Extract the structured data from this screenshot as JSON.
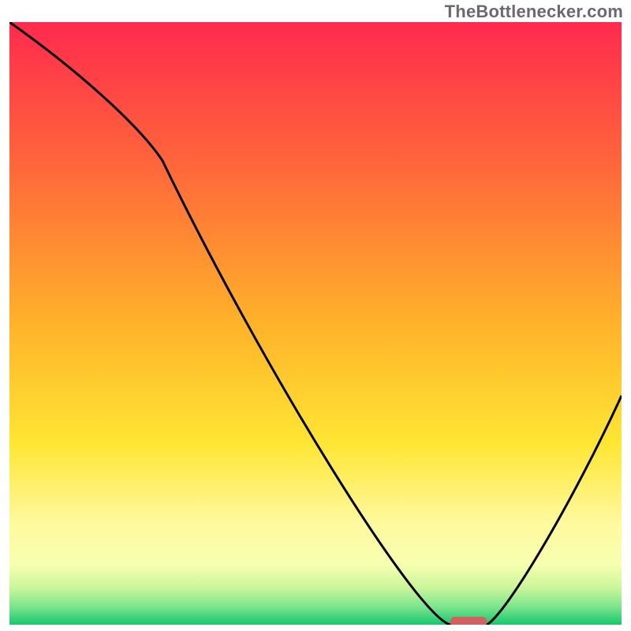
{
  "watermark": "TheBottleneсker.com",
  "chart_data": {
    "type": "line",
    "title": "",
    "xlabel": "",
    "ylabel": "",
    "xlim": [
      0,
      100
    ],
    "ylim": [
      0,
      100
    ],
    "x": [
      0,
      25,
      72,
      78,
      100
    ],
    "values": [
      100,
      77,
      0,
      0,
      38
    ],
    "notch": {
      "x_start": 72,
      "x_end": 78,
      "color": "#d16060"
    },
    "curve_color": "#000000",
    "background_gradient": {
      "stops": [
        {
          "offset": 0.0,
          "color": "#ff2a4d"
        },
        {
          "offset": 0.25,
          "color": "#ff6a3a"
        },
        {
          "offset": 0.5,
          "color": "#ffb22a"
        },
        {
          "offset": 0.7,
          "color": "#ffe633"
        },
        {
          "offset": 0.83,
          "color": "#fff99e"
        },
        {
          "offset": 0.9,
          "color": "#f7ffb0"
        },
        {
          "offset": 0.94,
          "color": "#c8f59a"
        },
        {
          "offset": 0.97,
          "color": "#7de58e"
        },
        {
          "offset": 1.0,
          "color": "#18c76d"
        }
      ]
    }
  }
}
